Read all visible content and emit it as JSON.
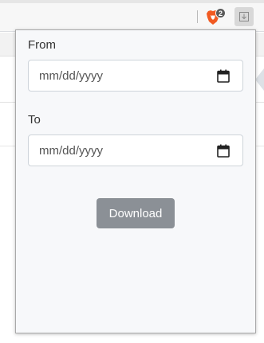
{
  "browser": {
    "brave_shields_count": "2"
  },
  "popup": {
    "from": {
      "label": "From",
      "placeholder": "mm/dd/yyyy"
    },
    "to": {
      "label": "To",
      "placeholder": "mm/dd/yyyy"
    },
    "download_label": "Download"
  },
  "icons": {
    "brave": "brave-lion-icon",
    "extension": "download-extension-icon",
    "calendar": "calendar-icon"
  },
  "colors": {
    "popup_background": "#f7f8fa",
    "button_background": "#8b9096",
    "input_border": "#ced4da"
  }
}
